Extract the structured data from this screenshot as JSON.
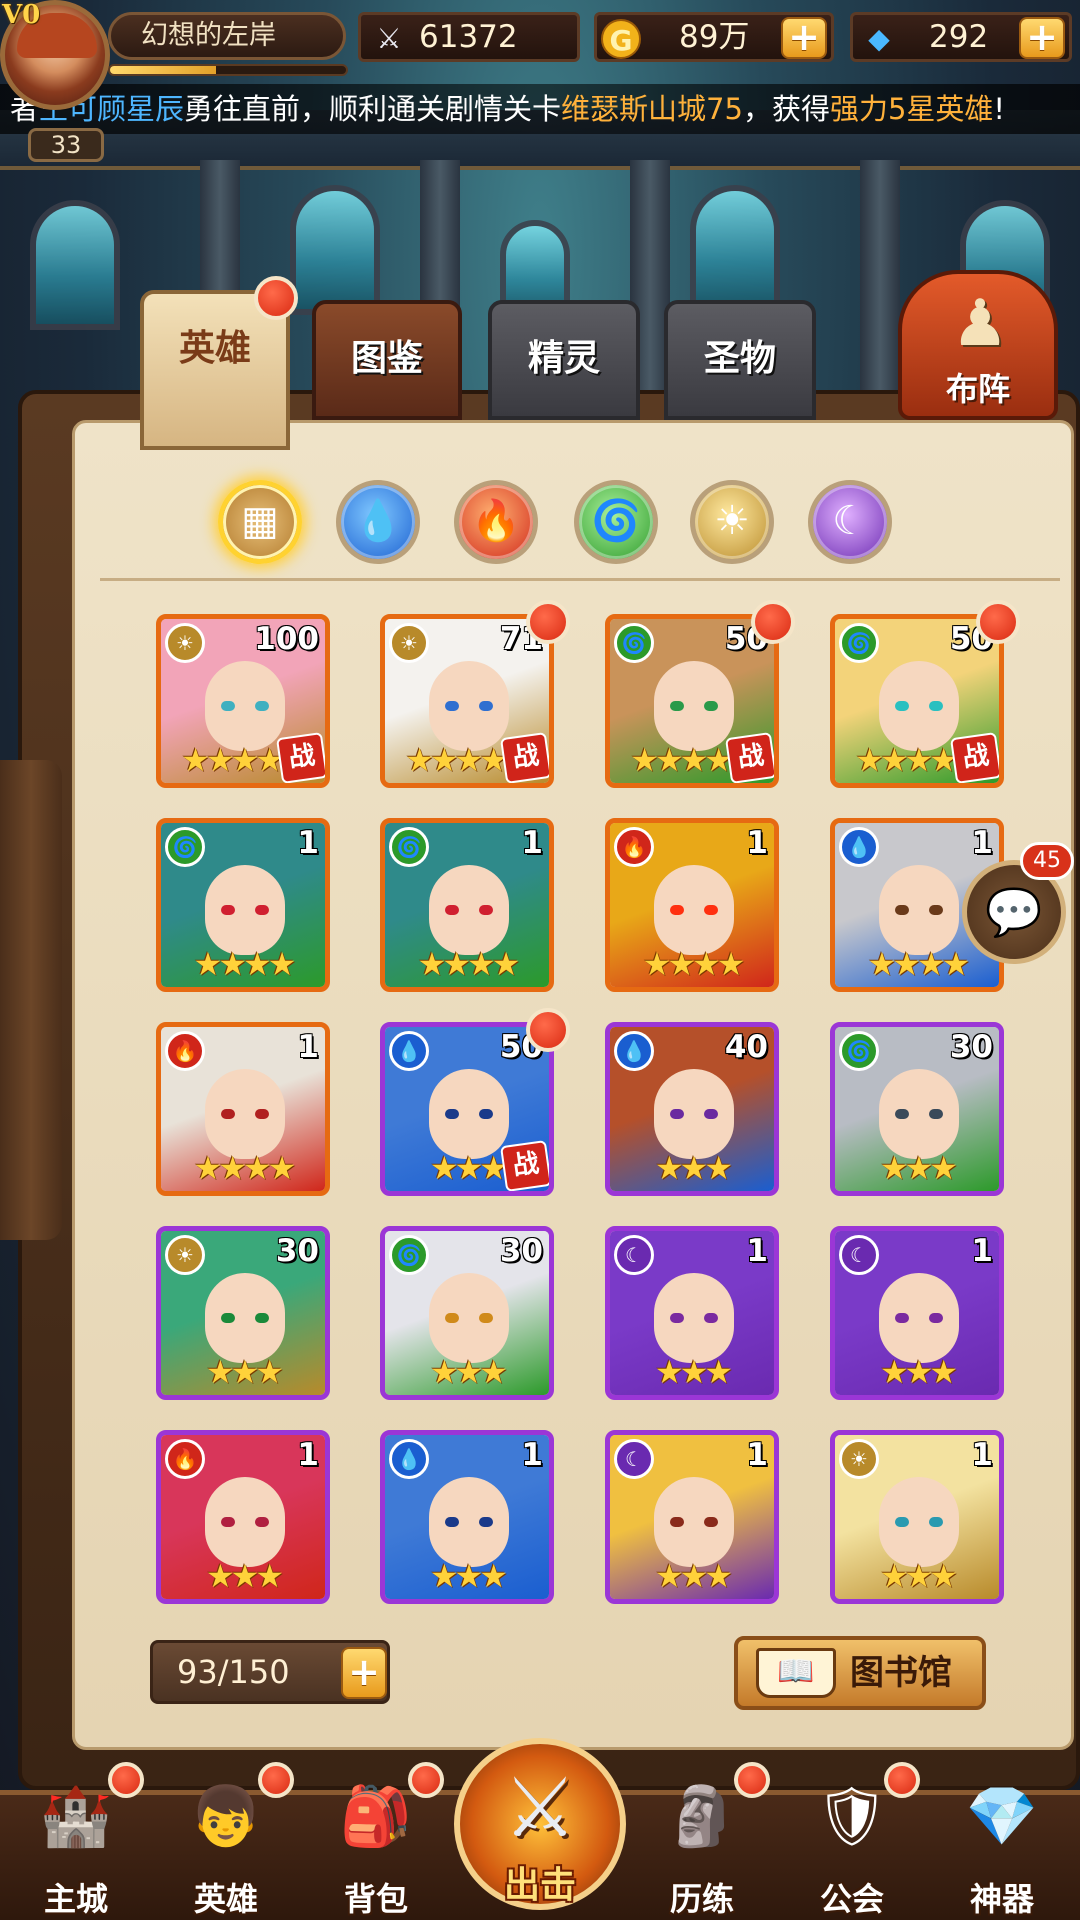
{
  "player": {
    "vip": "V0",
    "name": "幻想的左岸",
    "level": "33",
    "exp_fraction": 0.45
  },
  "resources": {
    "power": "61372",
    "gold": "89万",
    "gems": "292"
  },
  "ticker": {
    "prefix": "者",
    "player": "王可顾星辰",
    "text1": "勇往直前，顺利通关剧情关卡",
    "stage": "维瑟斯山城75",
    "text2": "，获得",
    "reward": "强力5星英雄",
    "suffix": "!"
  },
  "tabs": [
    {
      "label": "英雄"
    },
    {
      "label": "图鉴"
    },
    {
      "label": "精灵"
    },
    {
      "label": "圣物"
    }
  ],
  "formation": {
    "label": "布阵"
  },
  "filters": [
    {
      "name": "all",
      "glyph": "▦"
    },
    {
      "name": "water",
      "glyph": "💧"
    },
    {
      "name": "fire",
      "glyph": "🔥"
    },
    {
      "name": "wind",
      "glyph": "🌀"
    },
    {
      "name": "light",
      "glyph": "☀"
    },
    {
      "name": "dark",
      "glyph": "☾"
    }
  ],
  "heroes": [
    {
      "element": "light",
      "level": "100",
      "stars": 5,
      "rarity": "orange",
      "battle": true,
      "dot": false,
      "hair": "#f2a4b8",
      "eye": "#3fb0c0"
    },
    {
      "element": "light",
      "level": "71",
      "stars": 5,
      "rarity": "orange",
      "battle": true,
      "dot": true,
      "hair": "#f4f2ee",
      "eye": "#2f6fd0"
    },
    {
      "element": "wind",
      "level": "50",
      "stars": 5,
      "rarity": "orange",
      "battle": true,
      "dot": true,
      "hair": "#c9935a",
      "eye": "#2a9a4a"
    },
    {
      "element": "wind",
      "level": "50",
      "stars": 5,
      "rarity": "orange",
      "battle": true,
      "dot": true,
      "hair": "#f3d37a",
      "eye": "#2ac0c0"
    },
    {
      "element": "wind",
      "level": "1",
      "stars": 4,
      "rarity": "orange",
      "battle": false,
      "dot": false,
      "hair": "#2f8a8a",
      "eye": "#d02030"
    },
    {
      "element": "wind",
      "level": "1",
      "stars": 4,
      "rarity": "orange",
      "battle": false,
      "dot": false,
      "hair": "#2f8a8a",
      "eye": "#d02030"
    },
    {
      "element": "fire",
      "level": "1",
      "stars": 4,
      "rarity": "orange",
      "battle": false,
      "dot": false,
      "hair": "#e8a818",
      "eye": "#ff3010"
    },
    {
      "element": "water",
      "level": "1",
      "stars": 4,
      "rarity": "orange",
      "battle": false,
      "dot": false,
      "hair": "#c8c8cc",
      "eye": "#6a3a1a"
    },
    {
      "element": "fire",
      "level": "1",
      "stars": 4,
      "rarity": "orange",
      "battle": false,
      "dot": false,
      "hair": "#e8e2d8",
      "eye": "#b02020"
    },
    {
      "element": "water",
      "level": "50",
      "stars": 3,
      "rarity": "purple",
      "battle": true,
      "dot": true,
      "hair": "#3f7ad6",
      "eye": "#1a3a8a"
    },
    {
      "element": "water",
      "level": "40",
      "stars": 3,
      "rarity": "purple",
      "battle": false,
      "dot": false,
      "hair": "#b5502a",
      "eye": "#6a2aa0"
    },
    {
      "element": "wind",
      "level": "30",
      "stars": 3,
      "rarity": "purple",
      "battle": false,
      "dot": false,
      "hair": "#b8bcc4",
      "eye": "#3a4a5a"
    },
    {
      "element": "light",
      "level": "30",
      "stars": 3,
      "rarity": "purple",
      "battle": false,
      "dot": false,
      "hair": "#3aa87a",
      "eye": "#1a8a3a"
    },
    {
      "element": "wind",
      "level": "30",
      "stars": 3,
      "rarity": "purple",
      "battle": false,
      "dot": false,
      "hair": "#e4e4ea",
      "eye": "#d08a1a"
    },
    {
      "element": "dark",
      "level": "1",
      "stars": 3,
      "rarity": "purple",
      "battle": false,
      "dot": false,
      "hair": "#7a3ac8",
      "eye": "#7a2aa0"
    },
    {
      "element": "dark",
      "level": "1",
      "stars": 3,
      "rarity": "purple",
      "battle": false,
      "dot": false,
      "hair": "#7a3ac8",
      "eye": "#7a2aa0"
    },
    {
      "element": "fire",
      "level": "1",
      "stars": 3,
      "rarity": "purple",
      "battle": false,
      "dot": false,
      "hair": "#d8365a",
      "eye": "#b02040"
    },
    {
      "element": "water",
      "level": "1",
      "stars": 3,
      "rarity": "purple",
      "battle": false,
      "dot": false,
      "hair": "#3f7ad6",
      "eye": "#1a3a8a"
    },
    {
      "element": "dark",
      "level": "1",
      "stars": 3,
      "rarity": "purple",
      "battle": false,
      "dot": false,
      "hair": "#f0c040",
      "eye": "#8a2a1a"
    },
    {
      "element": "light",
      "level": "1",
      "stars": 3,
      "rarity": "purple",
      "battle": false,
      "dot": false,
      "hair": "#f3e2a0",
      "eye": "#2a9ab0"
    }
  ],
  "battle_badge": "战",
  "chat": {
    "count": "45"
  },
  "capacity": "93/150",
  "library": {
    "label": "图书馆"
  },
  "nav": [
    {
      "label": "主城",
      "icon": "🏰",
      "dot": true
    },
    {
      "label": "英雄",
      "icon": "👦",
      "dot": true
    },
    {
      "label": "背包",
      "icon": "🎒",
      "dot": true
    },
    {
      "label": "出击",
      "icon": "⚔",
      "dot": false
    },
    {
      "label": "历练",
      "icon": "🗿",
      "dot": true
    },
    {
      "label": "公会",
      "icon": "🛡",
      "dot": true
    },
    {
      "label": "神器",
      "icon": "💎",
      "dot": false
    }
  ],
  "colors": {
    "water": "#1a5ed0",
    "fire": "#d0261a",
    "wind": "#2c9a2a",
    "light": "#b88a2a",
    "dark": "#6a2ab0",
    "orange_frame": "#e66a12",
    "purple_frame": "#9b36d6"
  }
}
